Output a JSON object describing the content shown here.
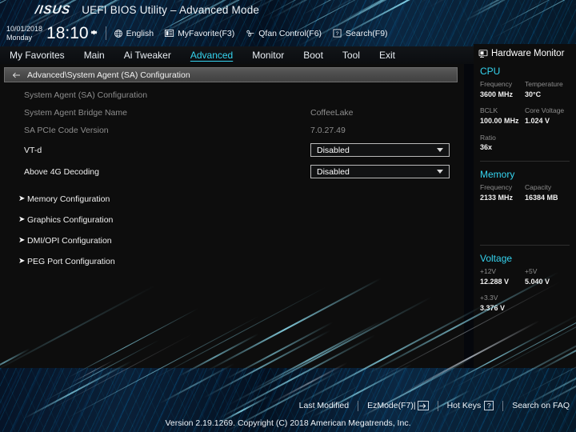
{
  "header": {
    "logo": "/ISUS",
    "title": "UEFI BIOS Utility – Advanced Mode",
    "date": "10/01/2018",
    "day": "Monday",
    "time": "18:10",
    "gear_icon": "gear-icon",
    "items": [
      {
        "label": "English",
        "icon": "globe-icon"
      },
      {
        "label": "MyFavorite(F3)",
        "icon": "favorite-list-icon"
      },
      {
        "label": "Qfan Control(F6)",
        "icon": "fan-icon"
      },
      {
        "label": "Search(F9)",
        "icon": "question-box-icon"
      }
    ]
  },
  "nav": {
    "tabs": [
      {
        "label": "My Favorites",
        "active": false
      },
      {
        "label": "Main",
        "active": false
      },
      {
        "label": "Ai Tweaker",
        "active": false
      },
      {
        "label": "Advanced",
        "active": true
      },
      {
        "label": "Monitor",
        "active": false
      },
      {
        "label": "Boot",
        "active": false
      },
      {
        "label": "Tool",
        "active": false
      },
      {
        "label": "Exit",
        "active": false
      }
    ]
  },
  "breadcrumb": {
    "back_icon": "back-arrow-icon",
    "path": "Advanced\\System Agent (SA) Configuration"
  },
  "main": {
    "section_title": "System Agent (SA) Configuration",
    "info_rows": [
      {
        "label": "System Agent Bridge Name",
        "value": "CoffeeLake"
      },
      {
        "label": "SA PCIe Code Version",
        "value": "7.0.27.49"
      }
    ],
    "settings": [
      {
        "label": "VT-d",
        "value": "Disabled"
      },
      {
        "label": "Above 4G Decoding",
        "value": "Disabled"
      }
    ],
    "submenus": [
      "Memory Configuration",
      "Graphics Configuration",
      "DMI/OPI Configuration",
      "PEG Port Configuration"
    ],
    "info_icon": "info-circle-icon"
  },
  "sidebar": {
    "title": "Hardware Monitor",
    "title_icon": "monitor-icon",
    "sections": [
      {
        "name": "CPU",
        "rows": [
          [
            {
              "key": "Frequency",
              "value": "3600 MHz"
            },
            {
              "key": "Temperature",
              "value": "30°C"
            }
          ],
          [
            {
              "key": "BCLK",
              "value": "100.00 MHz"
            },
            {
              "key": "Core Voltage",
              "value": "1.024 V"
            }
          ],
          [
            {
              "key": "Ratio",
              "value": "36x"
            }
          ]
        ]
      },
      {
        "name": "Memory",
        "rows": [
          [
            {
              "key": "Frequency",
              "value": "2133 MHz"
            },
            {
              "key": "Capacity",
              "value": "16384 MB"
            }
          ]
        ]
      },
      {
        "name": "Voltage",
        "rows": [
          [
            {
              "key": "+12V",
              "value": "12.288 V"
            },
            {
              "key": "+5V",
              "value": "5.040 V"
            }
          ],
          [
            {
              "key": "+3.3V",
              "value": "3.376 V"
            }
          ]
        ]
      }
    ]
  },
  "footer": {
    "items": [
      {
        "label": "Last Modified",
        "key": ""
      },
      {
        "label": "EzMode(F7)|",
        "key": "arrow"
      },
      {
        "label": "Hot Keys",
        "key": "?"
      },
      {
        "label": "Search on FAQ",
        "key": ""
      }
    ],
    "version": "Version 2.19.1269. Copyright (C) 2018 American Megatrends, Inc."
  },
  "colors": {
    "accent": "#35d4ef",
    "panel": "#0d0d0d",
    "muted": "#8d8d8d"
  }
}
